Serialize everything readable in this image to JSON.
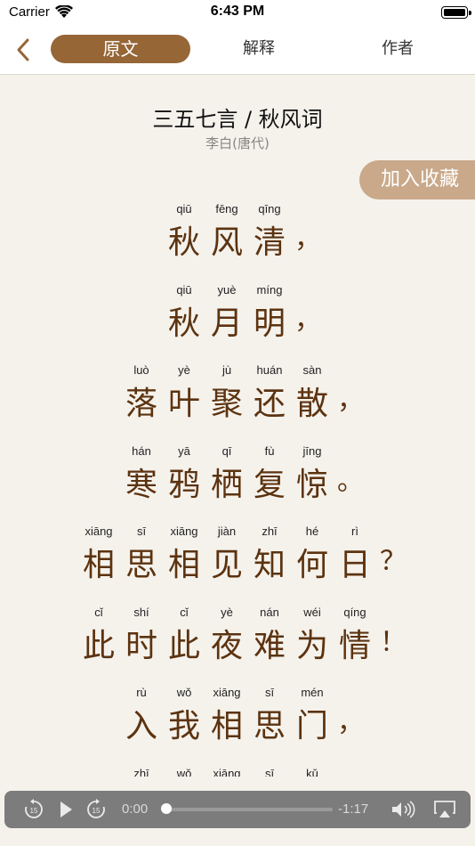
{
  "status": {
    "carrier": "Carrier",
    "time": "6:43 PM"
  },
  "nav": {
    "tab_original": "原文",
    "tab_explain": "解释",
    "tab_author": "作者"
  },
  "poem": {
    "title": "三五七言 / 秋风词",
    "author": "李白(唐代)",
    "favorite_label": "加入收藏",
    "lines": [
      {
        "syllables": [
          [
            "qiū",
            "秋"
          ],
          [
            "fēng",
            "风"
          ],
          [
            "qīng",
            "清"
          ]
        ],
        "punct": "，"
      },
      {
        "syllables": [
          [
            "qiū",
            "秋"
          ],
          [
            "yuè",
            "月"
          ],
          [
            "míng",
            "明"
          ]
        ],
        "punct": "，"
      },
      {
        "syllables": [
          [
            "luò",
            "落"
          ],
          [
            "yè",
            "叶"
          ],
          [
            "jù",
            "聚"
          ],
          [
            "huán",
            "还"
          ],
          [
            "sàn",
            "散"
          ]
        ],
        "punct": "，"
      },
      {
        "syllables": [
          [
            "hán",
            "寒"
          ],
          [
            "yā",
            "鸦"
          ],
          [
            "qī",
            "栖"
          ],
          [
            "fù",
            "复"
          ],
          [
            "jīng",
            "惊"
          ]
        ],
        "punct": "。"
      },
      {
        "syllables": [
          [
            "xiāng",
            "相"
          ],
          [
            "sī",
            "思"
          ],
          [
            "xiāng",
            "相"
          ],
          [
            "jiàn",
            "见"
          ],
          [
            "zhī",
            "知"
          ],
          [
            "hé",
            "何"
          ],
          [
            "rì",
            "日"
          ]
        ],
        "punct": "？"
      },
      {
        "syllables": [
          [
            "cǐ",
            "此"
          ],
          [
            "shí",
            "时"
          ],
          [
            "cǐ",
            "此"
          ],
          [
            "yè",
            "夜"
          ],
          [
            "nán",
            "难"
          ],
          [
            "wéi",
            "为"
          ],
          [
            "qíng",
            "情"
          ]
        ],
        "punct": "！"
      },
      {
        "syllables": [
          [
            "rù",
            "入"
          ],
          [
            "wǒ",
            "我"
          ],
          [
            "xiāng",
            "相"
          ],
          [
            "sī",
            "思"
          ],
          [
            "mén",
            "门"
          ]
        ],
        "punct": "，"
      },
      {
        "syllables": [
          [
            "zhī",
            ""
          ],
          [
            "wǒ",
            ""
          ],
          [
            "xiāng",
            ""
          ],
          [
            "sī",
            ""
          ],
          [
            "kǔ",
            ""
          ]
        ],
        "punct": ""
      }
    ]
  },
  "player": {
    "elapsed": "0:00",
    "remaining": "-1:17",
    "progress": 0
  }
}
